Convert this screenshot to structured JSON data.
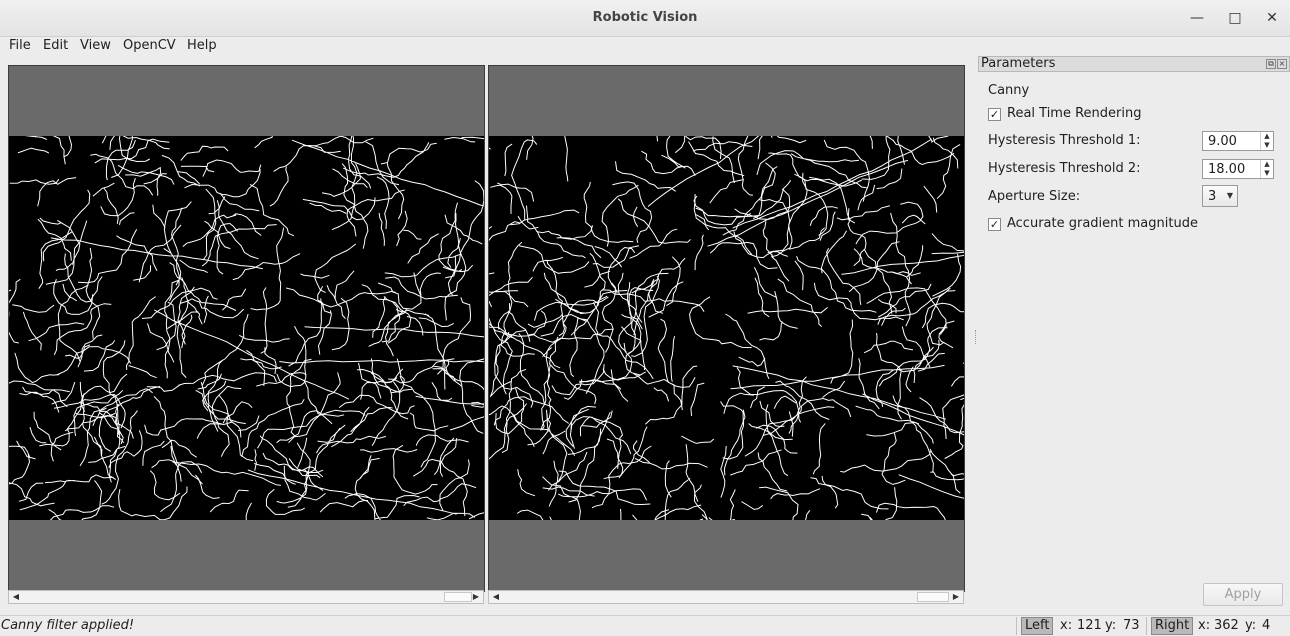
{
  "window": {
    "title": "Robotic Vision"
  },
  "window_controls": [
    "minimize-icon",
    "maximize-icon",
    "close-icon"
  ],
  "menu": {
    "items": [
      {
        "label": "File",
        "mnemonic": "F"
      },
      {
        "label": "Edit",
        "mnemonic": "E"
      },
      {
        "label": "View",
        "mnemonic": "V"
      },
      {
        "label": "OpenCV",
        "mnemonic": "O"
      },
      {
        "label": "Help",
        "mnemonic": "H"
      }
    ]
  },
  "parameters": {
    "title": "Parameters",
    "filter_name": "Canny",
    "real_time_rendering": {
      "label": "Real Time Rendering",
      "checked": true
    },
    "threshold1": {
      "label": "Hysteresis Threshold 1:",
      "value": "9.00"
    },
    "threshold2": {
      "label": "Hysteresis Threshold 2:",
      "value": "18.00"
    },
    "aperture": {
      "label": "Aperture Size:",
      "value": "3"
    },
    "accurate_gradient": {
      "label": "Accurate gradient magnitude",
      "checked": true
    },
    "apply_label": "Apply"
  },
  "viewers": {
    "left": {
      "image": "canny-edge-output-left"
    },
    "right": {
      "image": "canny-edge-output-right"
    }
  },
  "status": {
    "message": "Canny filter applied!",
    "left": {
      "badge": "Left",
      "x_label": "x:",
      "x": "121",
      "y_label": "y:",
      "y": "73"
    },
    "right": {
      "badge": "Right",
      "x_label": "x:",
      "x": "362",
      "y_label": "y:",
      "y": "4"
    }
  },
  "colors": {
    "viewer_bg": "#6a6a6a",
    "image_bg": "#000000",
    "edge": "#ffffff"
  }
}
